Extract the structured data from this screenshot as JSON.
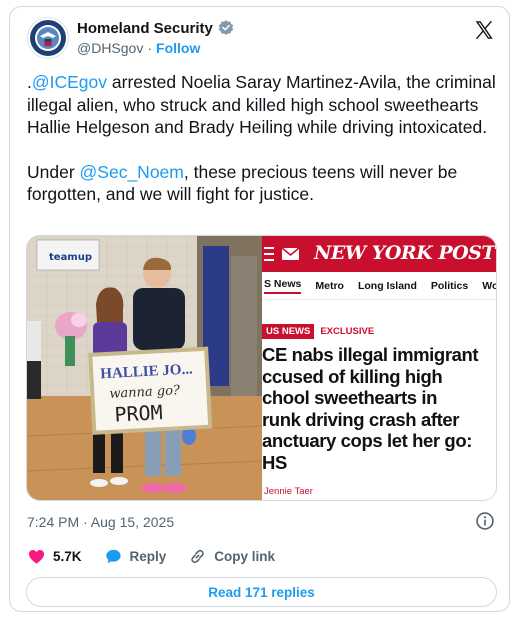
{
  "author": {
    "name": "Homeland Security",
    "handle": "@DHSgov",
    "separator": "·",
    "follow_label": "Follow"
  },
  "tweet": {
    "paragraph1": {
      "prefix": ".",
      "mention": "@ICEgov",
      "text": " arrested Noelia Saray Martinez-Avila, the criminal illegal alien, who struck and killed high school sweethearts Hallie Helgeson and Brady Heiling while driving intoxicated."
    },
    "paragraph2": {
      "prefix": "Under ",
      "mention": "@Sec_Noem",
      "text": ", these precious teens will never be forgotten, and we will fight for justice."
    }
  },
  "media": {
    "photo": {
      "banner_text": "teamup",
      "sign_line1": "HALLIE JO...",
      "sign_line2": "wanna go?",
      "sign_line3": "PROM"
    },
    "article": {
      "logo": "NEW YORK POST",
      "nav": [
        "S News",
        "Metro",
        "Long Island",
        "Politics",
        "Wor"
      ],
      "tag_news": "US NEWS",
      "tag_exclusive": "EXCLUSIVE",
      "headline_lines": [
        "CE nabs illegal immigrant",
        "ccused of killing high",
        "chool sweethearts in",
        "runk driving crash after",
        "anctuary cops let her go:",
        "HS"
      ],
      "byline": "Jennie Taer"
    }
  },
  "meta": {
    "timestamp": "7:24 PM · Aug 15, 2025"
  },
  "actions": {
    "like_count": "5.7K",
    "reply_label": "Reply",
    "copy_label": "Copy link"
  },
  "replies_button": "Read 171 replies",
  "colors": {
    "accent": "#1d9bf0",
    "like": "#f91880",
    "nypost_red": "#c8102e"
  }
}
